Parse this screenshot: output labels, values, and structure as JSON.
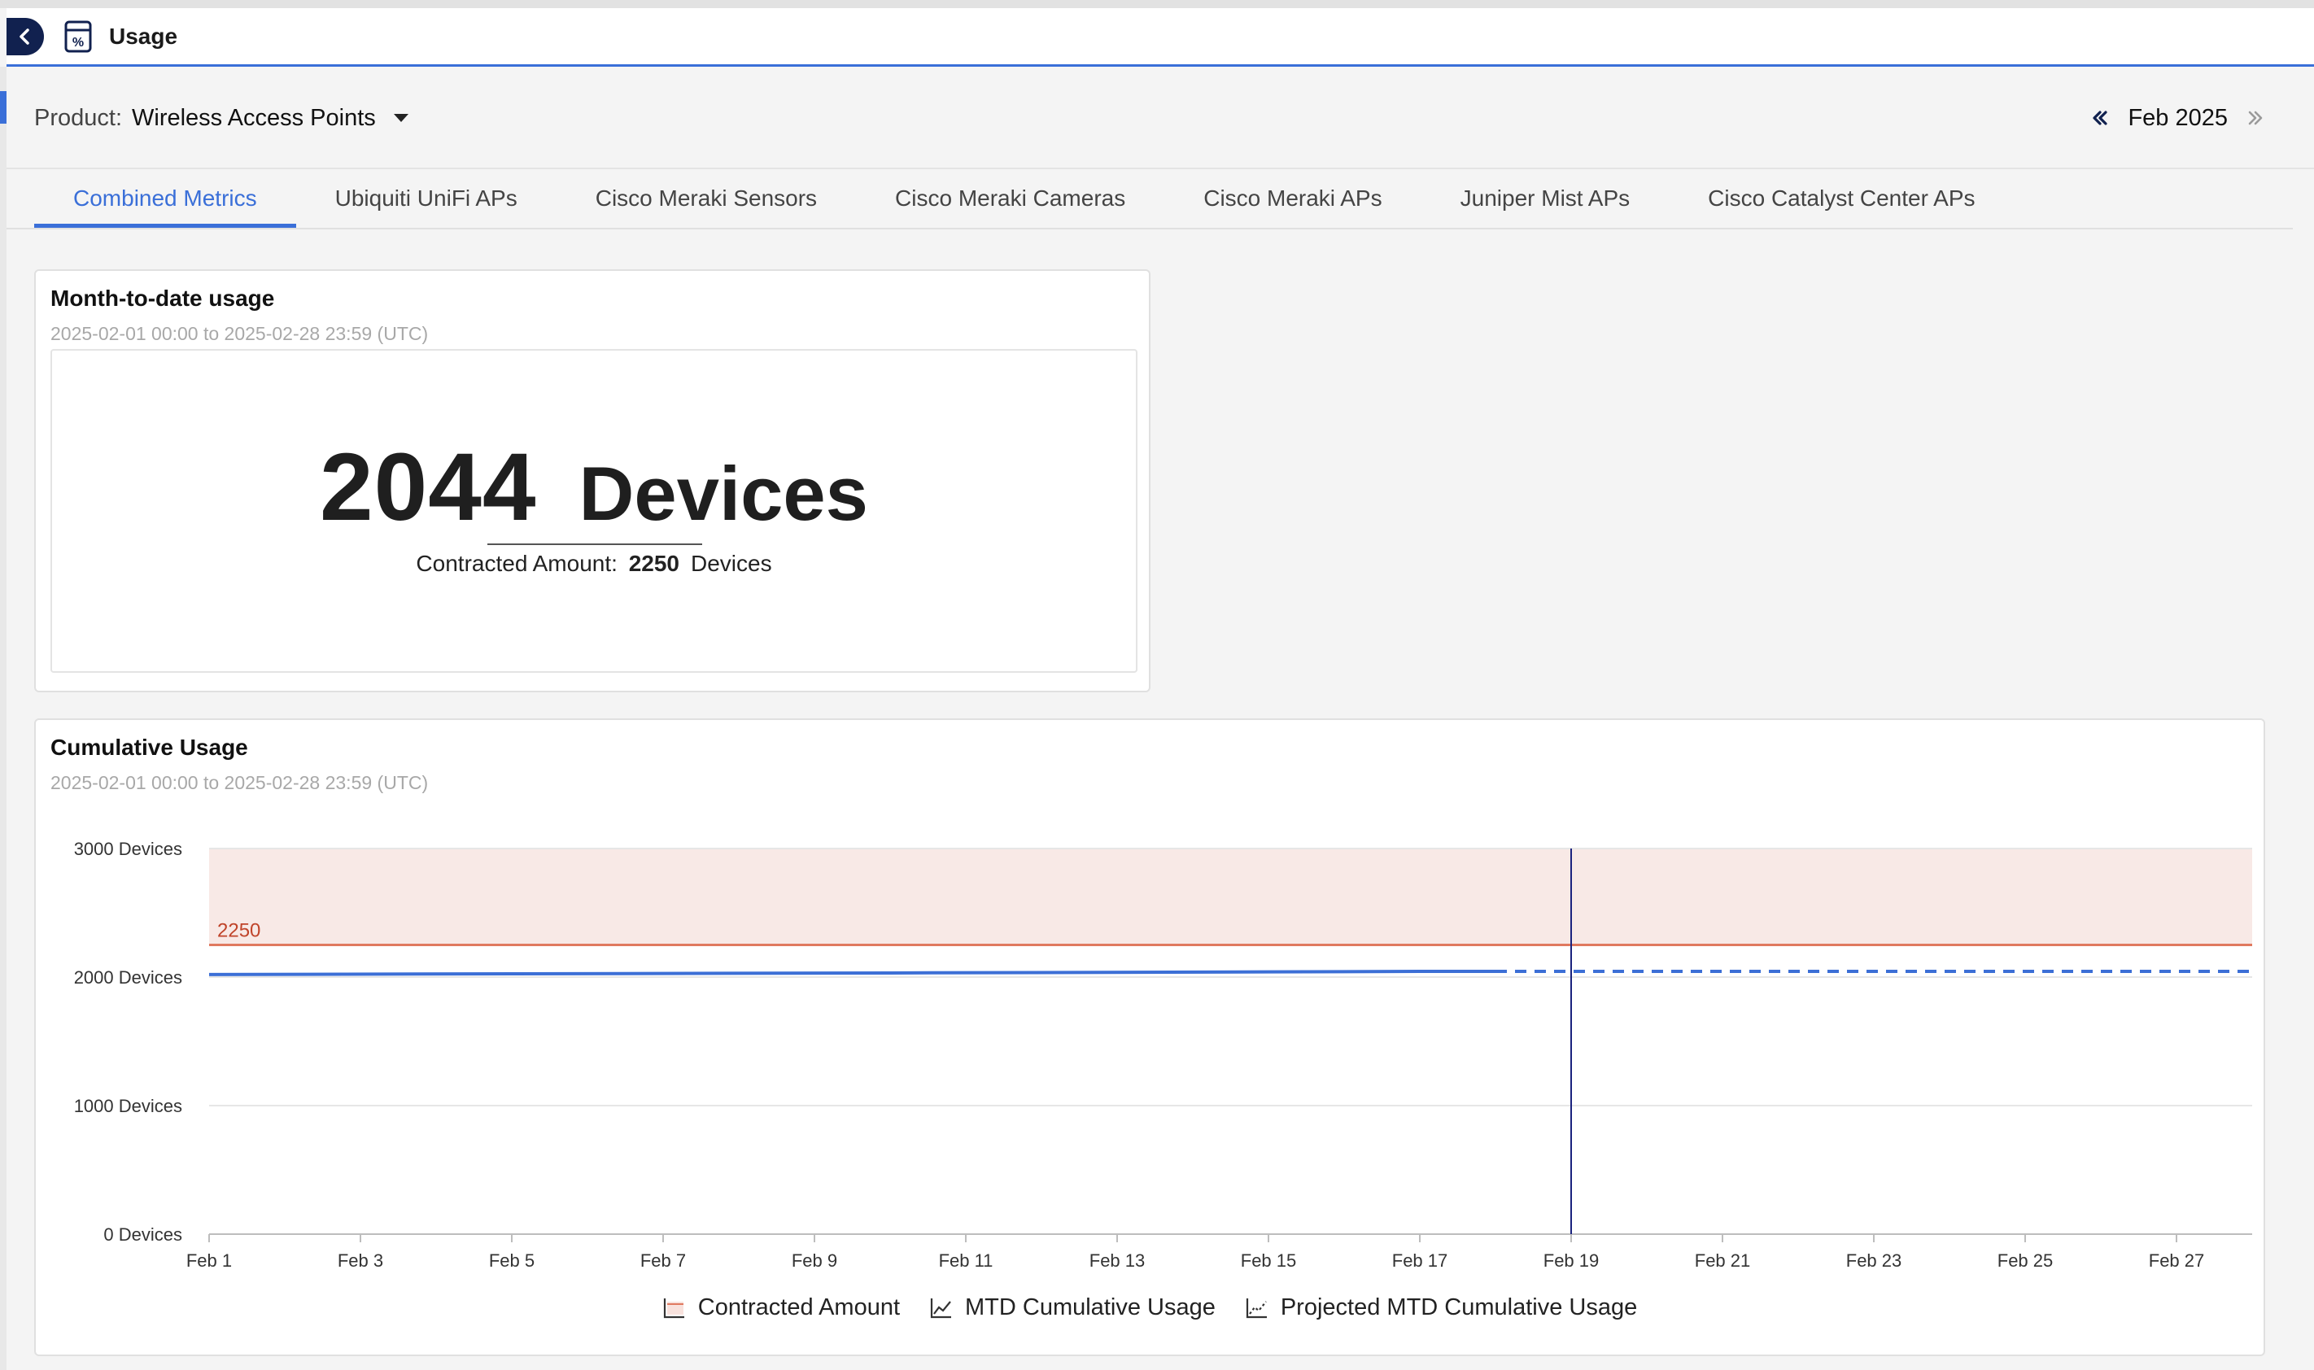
{
  "header": {
    "title": "Usage",
    "back_icon": "chevron-left-icon",
    "app_icon": "usage-calculator-icon"
  },
  "product": {
    "label": "Product:",
    "value": "Wireless Access Points"
  },
  "month_nav": {
    "label": "Feb 2025"
  },
  "tabs": [
    {
      "label": "Combined Metrics",
      "active": true
    },
    {
      "label": "Ubiquiti UniFi APs"
    },
    {
      "label": "Cisco Meraki Sensors"
    },
    {
      "label": "Cisco Meraki Cameras"
    },
    {
      "label": "Cisco Meraki APs"
    },
    {
      "label": "Juniper Mist APs"
    },
    {
      "label": "Cisco Catalyst Center APs"
    }
  ],
  "mtd_card": {
    "title": "Month-to-date usage",
    "range": "2025-02-01 00:00 to 2025-02-28 23:59 (UTC)",
    "value": "2044",
    "unit": "Devices",
    "contracted_label": "Contracted Amount:",
    "contracted_value": "2250",
    "contracted_unit": "Devices"
  },
  "cumulative_card": {
    "title": "Cumulative Usage",
    "range": "2025-02-01 00:00 to 2025-02-28 23:59 (UTC)"
  },
  "legend": {
    "contracted": "Contracted Amount",
    "mtd": "MTD Cumulative Usage",
    "projected": "Projected MTD Cumulative Usage"
  },
  "colors": {
    "accent": "#3a6fd8",
    "contracted_line": "#e0795f",
    "contracted_band": "#f8e9e6",
    "usage_line": "#3c6fd6",
    "marker_line": "#1a237e"
  },
  "chart_data": {
    "type": "line",
    "title": "Cumulative Usage",
    "ylim": [
      0,
      3000
    ],
    "y_ticks": [
      0,
      1000,
      2000,
      3000
    ],
    "y_tick_labels": [
      "0 Devices",
      "1000 Devices",
      "2000 Devices",
      "3000 Devices"
    ],
    "xlim": [
      "2025-02-01",
      "2025-02-28"
    ],
    "x_ticks": [
      "2025-02-01",
      "2025-02-03",
      "2025-02-05",
      "2025-02-07",
      "2025-02-09",
      "2025-02-11",
      "2025-02-13",
      "2025-02-15",
      "2025-02-17",
      "2025-02-19",
      "2025-02-21",
      "2025-02-23",
      "2025-02-25",
      "2025-02-27"
    ],
    "x_tick_labels": [
      "Feb 1",
      "Feb 3",
      "Feb 5",
      "Feb 7",
      "Feb 9",
      "Feb 11",
      "Feb 13",
      "Feb 15",
      "Feb 17",
      "Feb 19",
      "Feb 21",
      "Feb 23",
      "Feb 25",
      "Feb 27"
    ],
    "contracted_amount": 2250,
    "contracted_label": "2250",
    "marker_date": "2025-02-19",
    "grid": true,
    "legend_position": "bottom",
    "series": [
      {
        "name": "MTD Cumulative Usage",
        "style": "solid",
        "x": [
          "2025-02-01",
          "2025-02-05",
          "2025-02-10",
          "2025-02-15",
          "2025-02-17",
          "2025-02-18"
        ],
        "y": [
          2020,
          2025,
          2032,
          2040,
          2044,
          2044
        ]
      },
      {
        "name": "Projected MTD Cumulative Usage",
        "style": "dashed",
        "x": [
          "2025-02-18",
          "2025-02-28"
        ],
        "y": [
          2044,
          2044
        ]
      }
    ]
  }
}
